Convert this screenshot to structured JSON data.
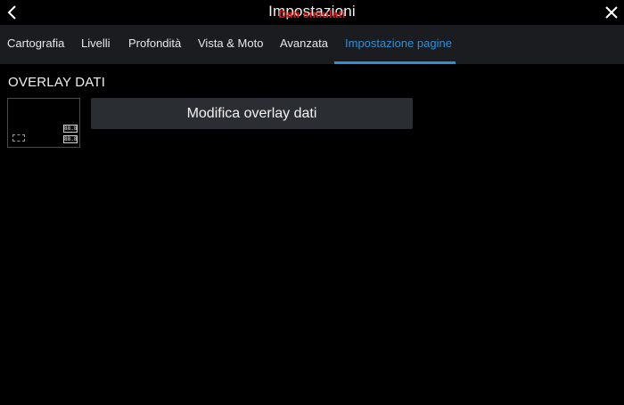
{
  "header": {
    "title": "Impostazioni",
    "simulation_banner": "Dati simulati",
    "back_icon": "chevron-left-icon",
    "close_icon": "close-icon"
  },
  "tabs": [
    {
      "label": "Cartografia",
      "active": false
    },
    {
      "label": "Livelli",
      "active": false
    },
    {
      "label": "Profondità",
      "active": false
    },
    {
      "label": "Vista & Moto",
      "active": false
    },
    {
      "label": "Avanzata",
      "active": false
    },
    {
      "label": "Impostazione pagine",
      "active": true
    }
  ],
  "overlay": {
    "section_title": "OVERLAY DATI",
    "thumbnail_values": [
      "88.8",
      "88.8"
    ],
    "edit_button_label": "Modifica overlay dati"
  },
  "colors": {
    "accent": "#2f8fd6",
    "banner": "#e01b1b",
    "tabbar_bg": "#1a1c20",
    "button_bg": "#2a2d31"
  }
}
